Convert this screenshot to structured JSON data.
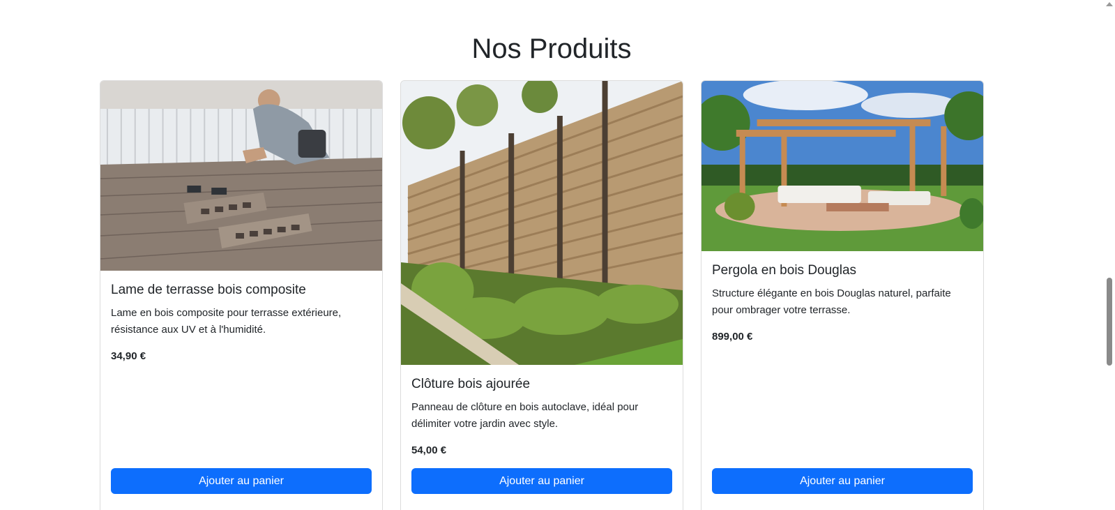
{
  "section": {
    "title": "Nos Produits"
  },
  "products": [
    {
      "image_alt": "Lame de terrasse bois composite",
      "title": "Lame de terrasse bois composite",
      "description": "Lame en bois composite pour terrasse extérieure, résistance aux UV et à l'humidité.",
      "price": "34,90 €",
      "button_label": "Ajouter au panier"
    },
    {
      "image_alt": "Clôture bois ajourée",
      "title": "Clôture bois ajourée",
      "description": "Panneau de clôture en bois autoclave, idéal pour délimiter votre jardin avec style.",
      "price": "54,00 €",
      "button_label": "Ajouter au panier"
    },
    {
      "image_alt": "Pergola en bois Douglas",
      "title": "Pergola en bois Douglas",
      "description": "Structure élégante en bois Douglas naturel, parfaite pour ombrager votre terrasse.",
      "price": "899,00 €",
      "button_label": "Ajouter au panier"
    }
  ],
  "colors": {
    "primary": "#0d6efd",
    "text": "#212529"
  }
}
